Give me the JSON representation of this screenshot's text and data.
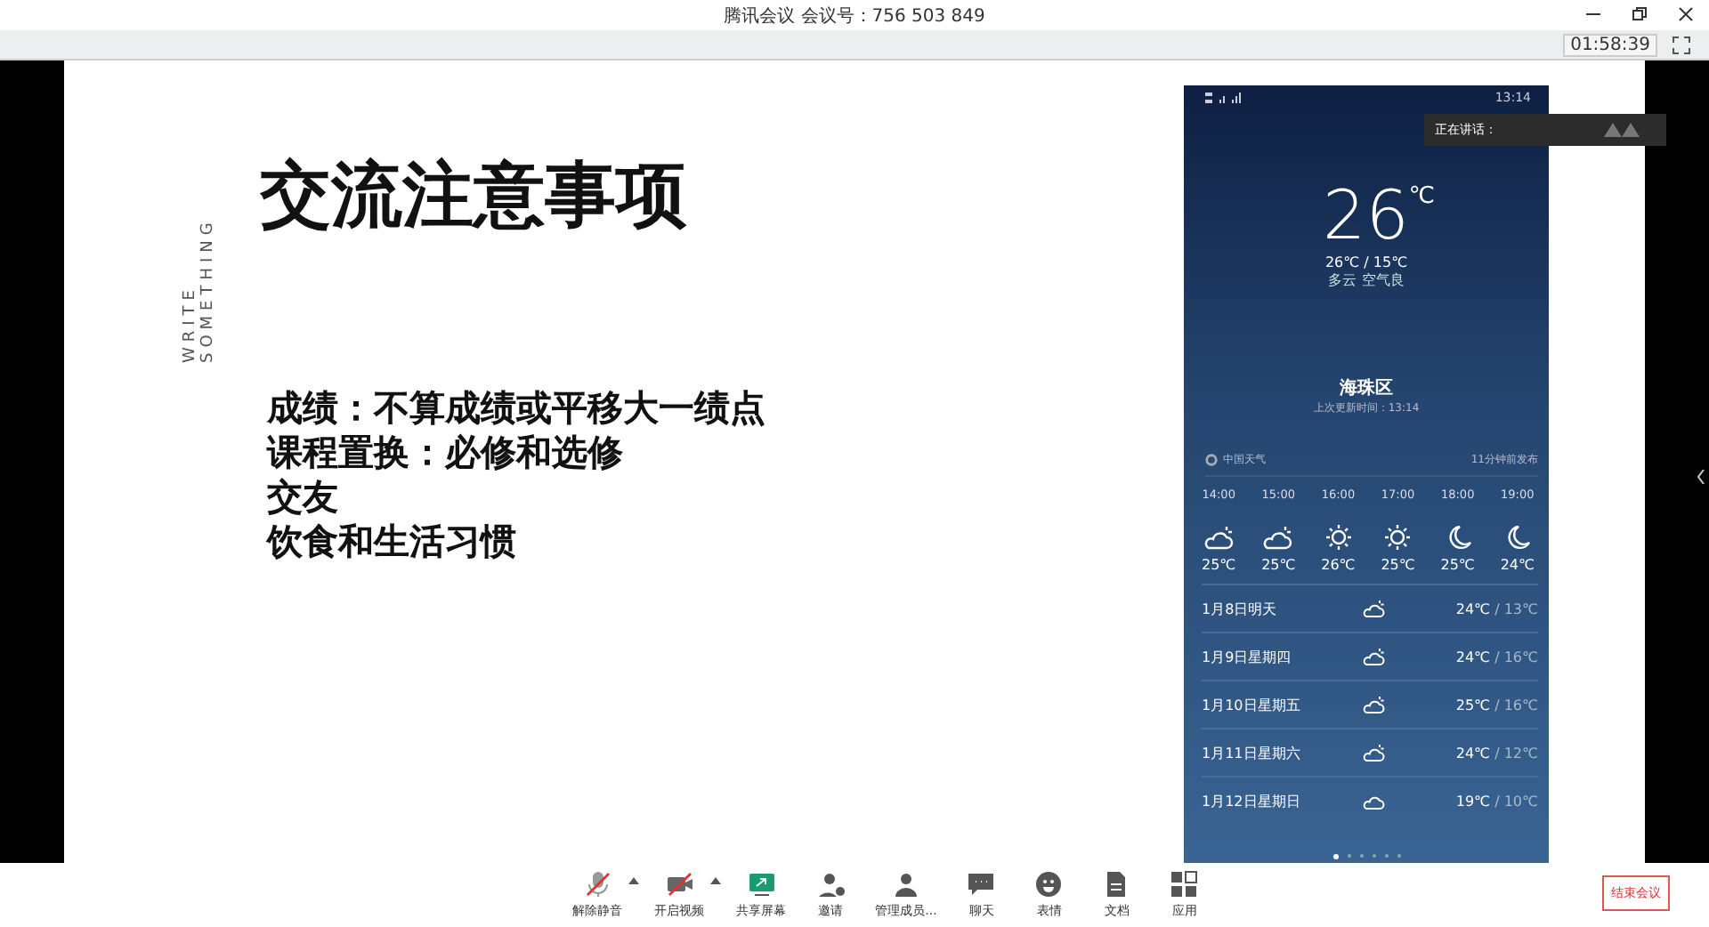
{
  "window": {
    "title": "腾讯会议 会议号：756 503 849",
    "timer": "01:58:39"
  },
  "slide": {
    "side_label": "WRITE SOMETHING",
    "title": "交流注意事项",
    "points": [
      "成绩：不算成绩或平移大一绩点",
      "课程置换：必修和选修",
      "交友",
      "饮食和生活习惯"
    ]
  },
  "phone": {
    "status_time": "13:14",
    "temp": "26",
    "unit": "℃",
    "range": "26℃ / 15℃",
    "condition": "多云  空气良",
    "location": "海珠区",
    "updated": "上次更新时间：13:14",
    "source": "中国天气",
    "published": "11分钟前发布",
    "hourly": [
      {
        "time": "14:00",
        "kind": "partly",
        "temp": "25℃"
      },
      {
        "time": "15:00",
        "kind": "partly",
        "temp": "25℃"
      },
      {
        "time": "16:00",
        "kind": "sun",
        "temp": "26℃"
      },
      {
        "time": "17:00",
        "kind": "sun",
        "temp": "25℃"
      },
      {
        "time": "18:00",
        "kind": "moon",
        "temp": "25℃"
      },
      {
        "time": "19:00",
        "kind": "moon",
        "temp": "24℃"
      }
    ],
    "daily": [
      {
        "day": "1月8日明天",
        "kind": "partly",
        "high": "24℃",
        "low": " / 13℃"
      },
      {
        "day": "1月9日星期四",
        "kind": "partly",
        "high": "24℃",
        "low": " / 16℃"
      },
      {
        "day": "1月10日星期五",
        "kind": "partly",
        "high": "25℃",
        "low": " / 16℃"
      },
      {
        "day": "1月11日星期六",
        "kind": "partly",
        "high": "24℃",
        "low": " / 12℃"
      },
      {
        "day": "1月12日星期日",
        "kind": "cloud",
        "high": "19℃",
        "low": " / 10℃"
      }
    ],
    "pages": [
      {
        "selected": true
      },
      {
        "selected": false
      },
      {
        "selected": false
      },
      {
        "selected": false
      },
      {
        "selected": false
      },
      {
        "selected": false
      }
    ]
  },
  "speaker": {
    "label": "正在讲话："
  },
  "toolbar": [
    {
      "label": "解除静音",
      "kind": "mic",
      "caret": true
    },
    {
      "label": "开启视频",
      "kind": "camera",
      "caret": true
    },
    {
      "label": "共享屏幕",
      "kind": "share",
      "caret": false
    },
    {
      "label": "邀请",
      "kind": "invite",
      "caret": false
    },
    {
      "label": "管理成员...",
      "kind": "members",
      "caret": false
    },
    {
      "label": "聊天",
      "kind": "chat",
      "caret": false
    },
    {
      "label": "表情",
      "kind": "smile",
      "caret": false
    },
    {
      "label": "文档",
      "kind": "doc",
      "caret": false
    },
    {
      "label": "应用",
      "kind": "apps",
      "caret": false
    }
  ],
  "end_button": "结束会议"
}
